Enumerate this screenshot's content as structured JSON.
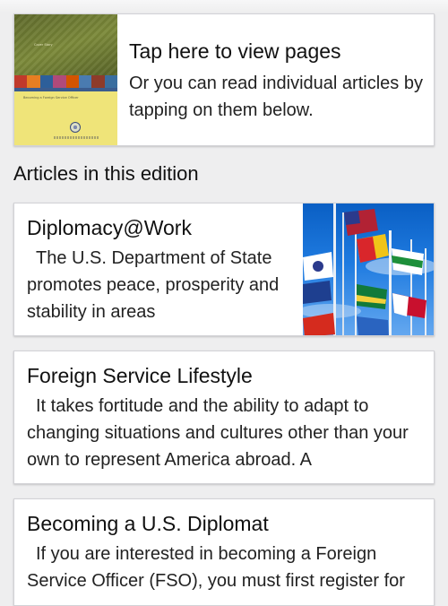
{
  "cover": {
    "title": "Tap here to view pages",
    "description": "Or you can read individual articles by tapping on them below.",
    "thumbnail_icon": "publication-cover-image",
    "thumbnail_tag": "Cover Story",
    "thumbnail_subtitle": "Becoming a Foreign Service Officer"
  },
  "section_heading": "Articles in this edition",
  "articles": [
    {
      "title": "Diplomacy@Work",
      "excerpt": "The U.S. Department of State promotes peace, prosperity and stability in areas",
      "image_icon": "flags-photo"
    },
    {
      "title": "Foreign Service Lifestyle",
      "excerpt": "It takes fortitude and the ability to adapt to changing situations and cultures other than your own to represent America abroad. A"
    },
    {
      "title": "Becoming a U.S. Diplomat",
      "excerpt": "If you are interested in becoming a Foreign Service Officer (FSO), you must first register for"
    }
  ],
  "colors": {
    "background": "#eeeeef",
    "card": "#ffffff",
    "cover_yellow": "#efe479",
    "cover_green": "#6b7832",
    "sky_blue": "#1f7be0"
  }
}
